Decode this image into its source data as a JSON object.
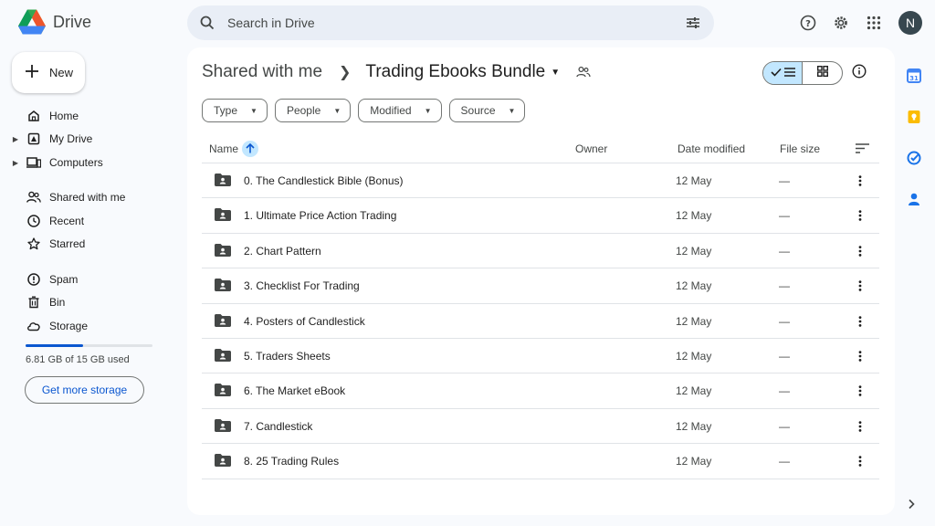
{
  "app": {
    "name": "Drive"
  },
  "search": {
    "placeholder": "Search in Drive"
  },
  "account": {
    "initial": "N"
  },
  "sidebar": {
    "new_label": "New",
    "items": [
      {
        "label": "Home",
        "icon": "home-icon",
        "expandable": false
      },
      {
        "label": "My Drive",
        "icon": "my-drive-icon",
        "expandable": true
      },
      {
        "label": "Computers",
        "icon": "computers-icon",
        "expandable": true
      },
      {
        "label": "Shared with me",
        "icon": "shared-icon",
        "expandable": false
      },
      {
        "label": "Recent",
        "icon": "clock-icon",
        "expandable": false
      },
      {
        "label": "Starred",
        "icon": "star-icon",
        "expandable": false
      },
      {
        "label": "Spam",
        "icon": "spam-icon",
        "expandable": false
      },
      {
        "label": "Bin",
        "icon": "bin-icon",
        "expandable": false
      },
      {
        "label": "Storage",
        "icon": "cloud-icon",
        "expandable": false
      }
    ],
    "storage": {
      "used_text": "6.81 GB of 15 GB used",
      "used_fraction": 0.454,
      "cta": "Get more storage"
    }
  },
  "breadcrumb": {
    "parent": "Shared with me",
    "current": "Trading Ebooks Bundle"
  },
  "filters": [
    "Type",
    "People",
    "Modified",
    "Source"
  ],
  "table": {
    "columns": {
      "name": "Name",
      "owner": "Owner",
      "date": "Date modified",
      "size": "File size"
    },
    "rows": [
      {
        "name": "0. The Candlestick Bible (Bonus)",
        "date": "12 May",
        "size": "—"
      },
      {
        "name": "1. Ultimate Price Action Trading",
        "date": "12 May",
        "size": "—"
      },
      {
        "name": "2. Chart Pattern",
        "date": "12 May",
        "size": "—"
      },
      {
        "name": "3. Checklist For Trading",
        "date": "12 May",
        "size": "—"
      },
      {
        "name": "4. Posters of Candlestick",
        "date": "12 May",
        "size": "—"
      },
      {
        "name": "5. Traders Sheets",
        "date": "12 May",
        "size": "—"
      },
      {
        "name": "6. The Market eBook",
        "date": "12 May",
        "size": "—"
      },
      {
        "name": "7. Candlestick",
        "date": "12 May",
        "size": "—"
      },
      {
        "name": "8. 25 Trading Rules",
        "date": "12 May",
        "size": "—"
      }
    ]
  },
  "colors": {
    "accent": "#0b57d0",
    "selected": "#c2e7ff",
    "calendar": "#4285f4",
    "keep": "#fbbc04",
    "tasks": "#1a73e8",
    "contacts": "#1a73e8"
  }
}
